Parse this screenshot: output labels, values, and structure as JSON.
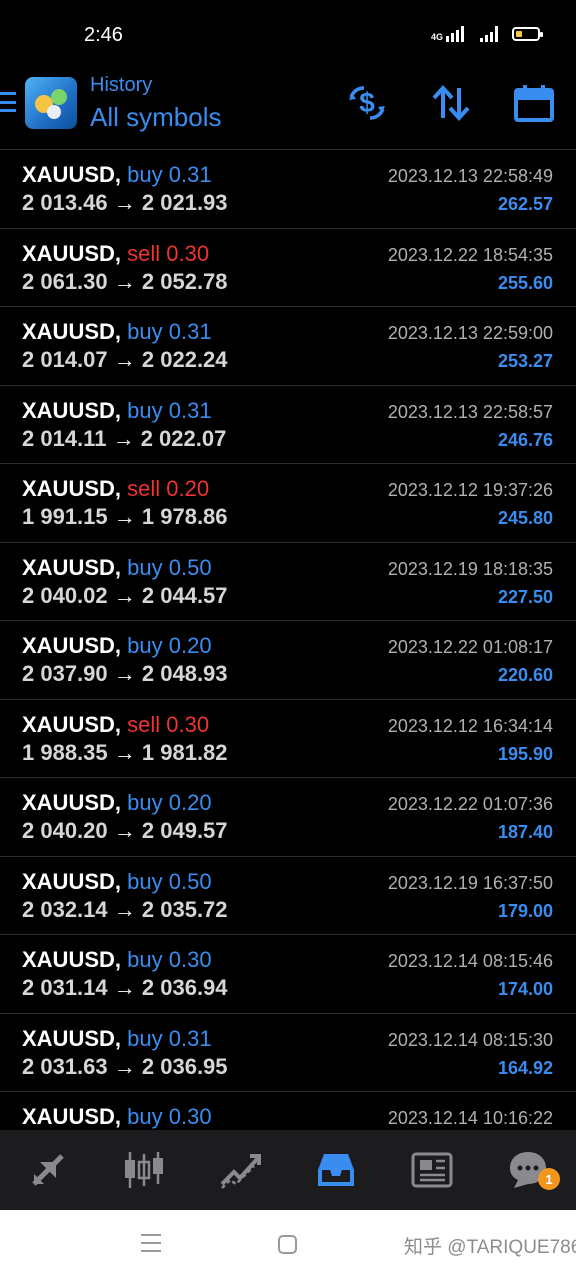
{
  "status_bar": {
    "time": "2:46",
    "network": "4G"
  },
  "header": {
    "subtitle": "History",
    "title": "All symbols"
  },
  "trades": [
    {
      "symbol": "XAUUSD,",
      "type": "buy",
      "volume": "0.31",
      "open": "2 013.46",
      "close": "2 021.93",
      "time": "2023.12.13 22:58:49",
      "profit": "262.57"
    },
    {
      "symbol": "XAUUSD,",
      "type": "sell",
      "volume": "0.30",
      "open": "2 061.30",
      "close": "2 052.78",
      "time": "2023.12.22 18:54:35",
      "profit": "255.60"
    },
    {
      "symbol": "XAUUSD,",
      "type": "buy",
      "volume": "0.31",
      "open": "2 014.07",
      "close": "2 022.24",
      "time": "2023.12.13 22:59:00",
      "profit": "253.27"
    },
    {
      "symbol": "XAUUSD,",
      "type": "buy",
      "volume": "0.31",
      "open": "2 014.11",
      "close": "2 022.07",
      "time": "2023.12.13 22:58:57",
      "profit": "246.76"
    },
    {
      "symbol": "XAUUSD,",
      "type": "sell",
      "volume": "0.20",
      "open": "1 991.15",
      "close": "1 978.86",
      "time": "2023.12.12 19:37:26",
      "profit": "245.80"
    },
    {
      "symbol": "XAUUSD,",
      "type": "buy",
      "volume": "0.50",
      "open": "2 040.02",
      "close": "2 044.57",
      "time": "2023.12.19 18:18:35",
      "profit": "227.50"
    },
    {
      "symbol": "XAUUSD,",
      "type": "buy",
      "volume": "0.20",
      "open": "2 037.90",
      "close": "2 048.93",
      "time": "2023.12.22 01:08:17",
      "profit": "220.60"
    },
    {
      "symbol": "XAUUSD,",
      "type": "sell",
      "volume": "0.30",
      "open": "1 988.35",
      "close": "1 981.82",
      "time": "2023.12.12 16:34:14",
      "profit": "195.90"
    },
    {
      "symbol": "XAUUSD,",
      "type": "buy",
      "volume": "0.20",
      "open": "2 040.20",
      "close": "2 049.57",
      "time": "2023.12.22 01:07:36",
      "profit": "187.40"
    },
    {
      "symbol": "XAUUSD,",
      "type": "buy",
      "volume": "0.50",
      "open": "2 032.14",
      "close": "2 035.72",
      "time": "2023.12.19 16:37:50",
      "profit": "179.00"
    },
    {
      "symbol": "XAUUSD,",
      "type": "buy",
      "volume": "0.30",
      "open": "2 031.14",
      "close": "2 036.94",
      "time": "2023.12.14 08:15:46",
      "profit": "174.00"
    },
    {
      "symbol": "XAUUSD,",
      "type": "buy",
      "volume": "0.31",
      "open": "2 031.63",
      "close": "2 036.95",
      "time": "2023.12.14 08:15:30",
      "profit": "164.92"
    },
    {
      "symbol": "XAUUSD,",
      "type": "buy",
      "volume": "0.30",
      "open": "",
      "close": "",
      "time": "2023.12.14 10:16:22",
      "profit": ""
    }
  ],
  "arrow_glyph": "→",
  "tabs": [
    {
      "name": "quotes",
      "icon": "arrows-up-down-icon"
    },
    {
      "name": "chart",
      "icon": "candlestick-icon"
    },
    {
      "name": "trade",
      "icon": "trend-line-icon"
    },
    {
      "name": "history",
      "icon": "inbox-icon",
      "active": true
    },
    {
      "name": "news",
      "icon": "newspaper-icon"
    },
    {
      "name": "messages",
      "icon": "chat-icon",
      "badge": "1"
    }
  ],
  "watermark": "知乎 @TARIQUE786",
  "colors": {
    "accent": "#3a8df0",
    "sell": "#f0332f",
    "background": "#000000",
    "tabbar": "#1c1c1e",
    "badge": "#f2961d"
  }
}
